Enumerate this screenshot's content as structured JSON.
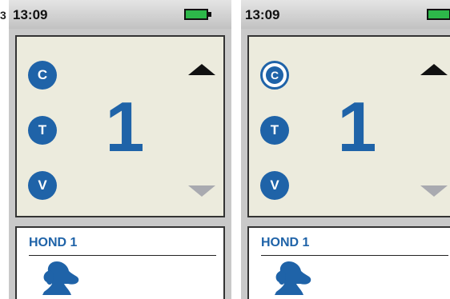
{
  "stray_text": "3",
  "screens": [
    {
      "status": {
        "time": "13:09",
        "battery_icon": "battery-full-icon",
        "battery_color": "#2db84a"
      },
      "modes": [
        {
          "letter": "C",
          "selected": false
        },
        {
          "letter": "T",
          "selected": false
        },
        {
          "letter": "V",
          "selected": false
        }
      ],
      "counter": "1",
      "up_arrow": {
        "icon": "arrow-up-icon",
        "enabled": true
      },
      "down_arrow": {
        "icon": "arrow-down-icon",
        "enabled": false
      },
      "dog": {
        "name": "HOND 1",
        "icon": "dog-head-icon"
      }
    },
    {
      "status": {
        "time": "13:09",
        "battery_icon": "battery-full-icon",
        "battery_color": "#2db84a"
      },
      "modes": [
        {
          "letter": "C",
          "selected": true
        },
        {
          "letter": "T",
          "selected": false
        },
        {
          "letter": "V",
          "selected": false
        }
      ],
      "counter": "1",
      "up_arrow": {
        "icon": "arrow-up-icon",
        "enabled": true
      },
      "down_arrow": {
        "icon": "arrow-down-icon",
        "enabled": false
      },
      "dog": {
        "name": "HOND 1",
        "icon": "dog-head-icon"
      }
    }
  ],
  "colors": {
    "accent": "#1f63a8",
    "panel": "#ecebdd",
    "disabled_arrow": "#a9aab0"
  }
}
